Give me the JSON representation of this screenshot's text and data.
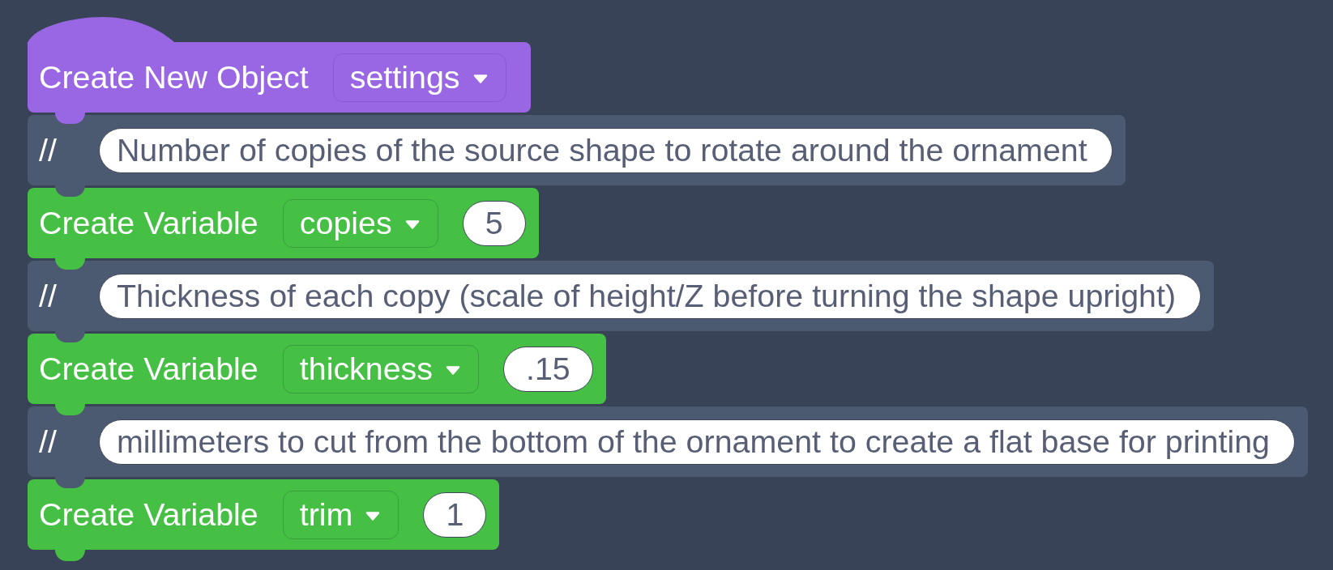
{
  "blocks": [
    {
      "kind": "object",
      "label": "Create New Object",
      "dropdown": "settings"
    },
    {
      "kind": "comment",
      "marker": "//",
      "text": "Number of copies of the source shape to rotate around the ornament"
    },
    {
      "kind": "variable",
      "label": "Create Variable",
      "dropdown": "copies",
      "value": "5"
    },
    {
      "kind": "comment",
      "marker": "//",
      "text": "Thickness of each copy (scale of height/Z before turning the shape upright)"
    },
    {
      "kind": "variable",
      "label": "Create Variable",
      "dropdown": "thickness",
      "value": ".15"
    },
    {
      "kind": "comment",
      "marker": "//",
      "text": "millimeters to cut from the bottom of the ornament to create a flat base for printing"
    },
    {
      "kind": "variable",
      "label": "Create Variable",
      "dropdown": "trim",
      "value": "1"
    }
  ]
}
